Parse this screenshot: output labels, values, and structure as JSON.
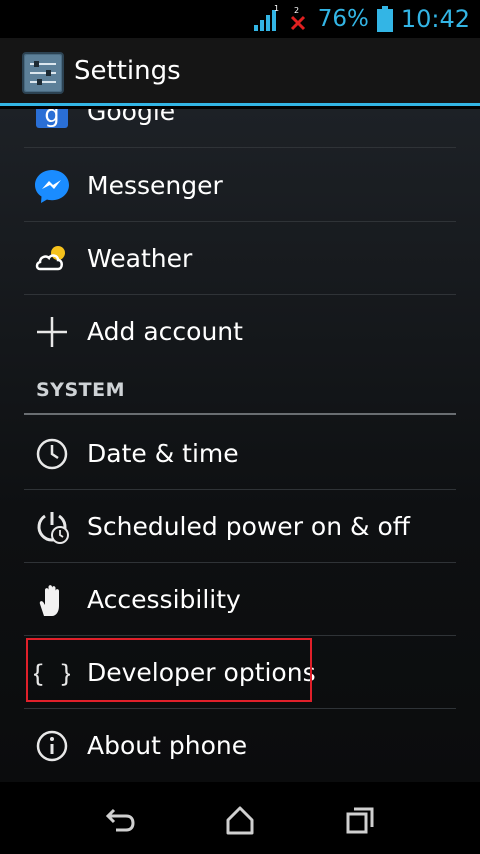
{
  "status_bar": {
    "signal_slot": "1",
    "missing_sim_slot": "2",
    "battery_percent": "76%",
    "time": "10:42",
    "accent_color": "#33b5e5"
  },
  "action_bar": {
    "title": "Settings",
    "icon": "settings-sliders-icon"
  },
  "accounts": [
    {
      "label": "Google",
      "icon": "google-icon"
    },
    {
      "label": "Messenger",
      "icon": "messenger-icon"
    },
    {
      "label": "Weather",
      "icon": "weather-icon"
    },
    {
      "label": "Add account",
      "icon": "plus-icon"
    }
  ],
  "system_header": "SYSTEM",
  "system_items": [
    {
      "label": "Date & time",
      "icon": "clock-icon"
    },
    {
      "label": "Scheduled power on & off",
      "icon": "power-clock-icon"
    },
    {
      "label": "Accessibility",
      "icon": "hand-icon"
    },
    {
      "label": "Developer options",
      "icon": "braces-icon",
      "highlighted": true
    },
    {
      "label": "About phone",
      "icon": "info-icon"
    }
  ],
  "nav_bar": {
    "back": "back-icon",
    "home": "home-icon",
    "recents": "recents-icon"
  },
  "highlight_color": "#e0202a"
}
